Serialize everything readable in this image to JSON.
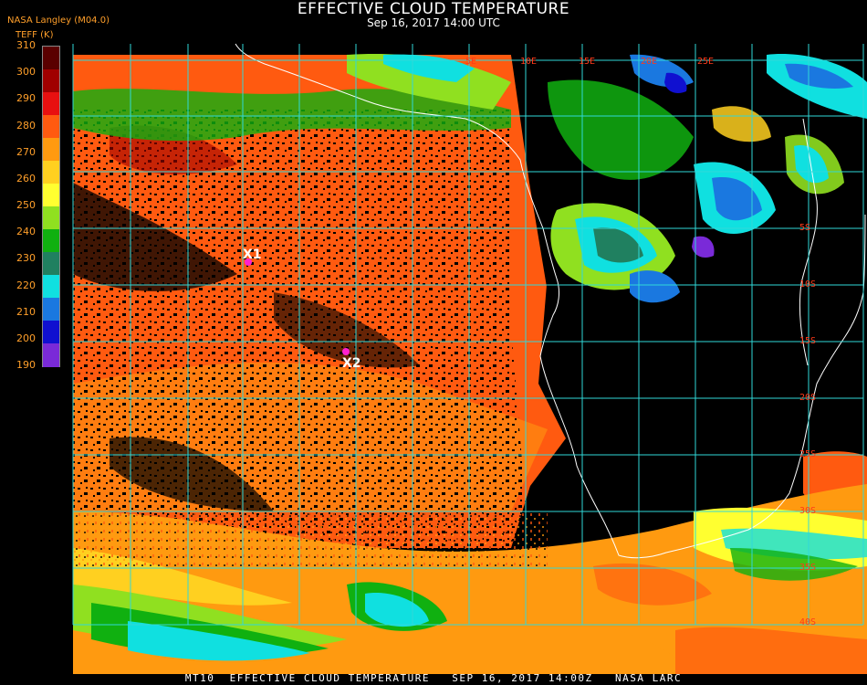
{
  "header": {
    "title": "EFFECTIVE CLOUD TEMPERATURE",
    "datetime": "Sep 16, 2017 14:00 UTC",
    "org": "NASA Langley (M04.0)",
    "units": "TEFF (K)"
  },
  "colorbar": {
    "labels": [
      "310",
      "300",
      "290",
      "280",
      "270",
      "260",
      "250",
      "240",
      "230",
      "220",
      "210",
      "200",
      "190"
    ],
    "colors": [
      "#5a0000",
      "#a00000",
      "#e81010",
      "#ff5a10",
      "#ff9a10",
      "#ffd020",
      "#ffff30",
      "#90e020",
      "#10b010",
      "#208060",
      "#10e0e0",
      "#1a78e0",
      "#1010d0",
      "#7a2ad8"
    ]
  },
  "map": {
    "grid_color": "#30d8d8",
    "coast_color": "#ffffff",
    "lat_labels": [
      "5S",
      "10S",
      "15S",
      "20S",
      "25S",
      "30S",
      "35S",
      "40S"
    ],
    "lon_labels": [
      "5E",
      "10E",
      "15E",
      "20E",
      "25E"
    ],
    "markers": [
      {
        "name": "X1",
        "color": "#ff20d0"
      },
      {
        "name": "X2",
        "color": "#ff20d0"
      }
    ]
  },
  "footer": "MT10  EFFECTIVE CLOUD TEMPERATURE   SEP 16, 2017 14:00Z   NASA LARC"
}
